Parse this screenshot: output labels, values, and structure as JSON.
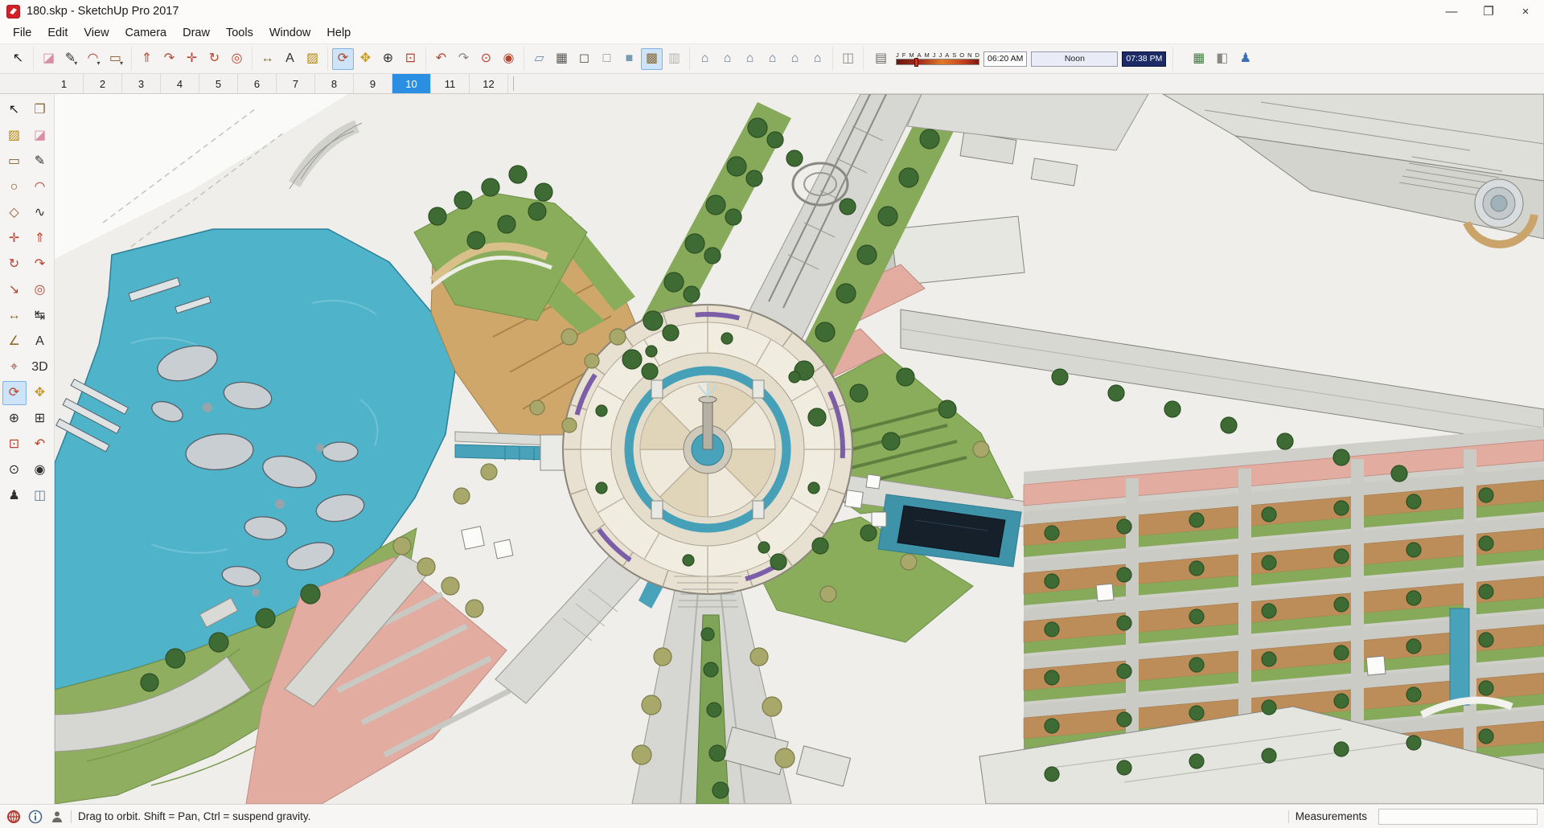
{
  "window": {
    "title": "180.skp - SketchUp Pro 2017",
    "controls": [
      {
        "name": "minimize",
        "glyph": "—"
      },
      {
        "name": "maximize",
        "glyph": "❐"
      },
      {
        "name": "close",
        "glyph": "×"
      }
    ]
  },
  "menu": {
    "items": [
      "File",
      "Edit",
      "View",
      "Camera",
      "Draw",
      "Tools",
      "Window",
      "Help"
    ]
  },
  "top_toolbar": {
    "groups": [
      {
        "name": "select",
        "tools": [
          {
            "name": "select",
            "glyph": "↖",
            "color": "#1a1a1a"
          }
        ]
      },
      {
        "name": "draw",
        "tools": [
          {
            "name": "eraser",
            "glyph": "◪",
            "color": "#d98fa5"
          },
          {
            "name": "line",
            "glyph": "✎",
            "color": "#2f2f2f",
            "dropdown": true
          },
          {
            "name": "arcs",
            "glyph": "◠",
            "color": "#b8452e",
            "dropdown": true
          },
          {
            "name": "shapes",
            "glyph": "▭",
            "color": "#8a5a2a",
            "dropdown": true
          }
        ]
      },
      {
        "name": "modify",
        "tools": [
          {
            "name": "push-pull",
            "glyph": "⇑",
            "color": "#b8452e"
          },
          {
            "name": "follow-me",
            "glyph": "↷",
            "color": "#b8452e"
          },
          {
            "name": "move",
            "glyph": "✛",
            "color": "#b8452e"
          },
          {
            "name": "rotate",
            "glyph": "↻",
            "color": "#b8452e"
          },
          {
            "name": "offset",
            "glyph": "◎",
            "color": "#b8452e"
          }
        ]
      },
      {
        "name": "construction",
        "tools": [
          {
            "name": "tape-measure",
            "glyph": "↔",
            "color": "#8a6b2a"
          },
          {
            "name": "text",
            "glyph": "A",
            "color": "#2f2f2f"
          },
          {
            "name": "paint-bucket",
            "glyph": "▨",
            "color": "#b8860b"
          }
        ]
      },
      {
        "name": "camera",
        "tools": [
          {
            "name": "orbit",
            "glyph": "⟳",
            "color": "#b8452e",
            "active": true
          },
          {
            "name": "pan",
            "glyph": "✥",
            "color": "#c9971e"
          },
          {
            "name": "zoom",
            "glyph": "⊕",
            "color": "#2f2f2f"
          },
          {
            "name": "zoom-extents",
            "glyph": "⊡",
            "color": "#b8452e"
          }
        ]
      },
      {
        "name": "walkthrough",
        "tools": [
          {
            "name": "previous",
            "glyph": "↶",
            "color": "#b8452e"
          },
          {
            "name": "next",
            "glyph": "↷",
            "color": "#8a8a84"
          },
          {
            "name": "position-camera",
            "glyph": "⊙",
            "color": "#b8452e"
          },
          {
            "name": "look-around",
            "glyph": "◉",
            "color": "#b8452e"
          }
        ]
      },
      {
        "name": "styles",
        "tools": [
          {
            "name": "x-ray",
            "glyph": "▱",
            "color": "#6a8fb0"
          },
          {
            "name": "back-edges",
            "glyph": "▦",
            "color": "#5a5a54"
          },
          {
            "name": "wireframe",
            "glyph": "◻",
            "color": "#5a5a54"
          },
          {
            "name": "hidden-line",
            "glyph": "□",
            "color": "#8a8a84"
          },
          {
            "name": "shaded",
            "glyph": "■",
            "color": "#7a9ab5"
          },
          {
            "name": "shaded-with-textures",
            "glyph": "▩",
            "color": "#8a6b3a",
            "active": true
          },
          {
            "name": "monochrome",
            "glyph": "▥",
            "color": "#b5b5af"
          }
        ]
      },
      {
        "name": "views",
        "tools": [
          {
            "name": "view-iso",
            "glyph": "⌂",
            "color": "#5a76a0"
          },
          {
            "name": "view-top",
            "glyph": "⌂",
            "color": "#5a76a0"
          },
          {
            "name": "view-front",
            "glyph": "⌂",
            "color": "#5a76a0"
          },
          {
            "name": "view-back",
            "glyph": "⌂",
            "color": "#5a76a0"
          },
          {
            "name": "view-left",
            "glyph": "⌂",
            "color": "#5a76a0"
          },
          {
            "name": "view-right",
            "glyph": "⌂",
            "color": "#5a76a0"
          }
        ]
      },
      {
        "name": "section",
        "tools": [
          {
            "name": "section-plane",
            "glyph": "◫",
            "color": "#8a8a84"
          }
        ]
      }
    ],
    "shadow": {
      "dialog_glyph": "▤",
      "months": [
        "J",
        "F",
        "M",
        "A",
        "M",
        "J",
        "J",
        "A",
        "S",
        "O",
        "N",
        "D"
      ],
      "start_time": "06:20 AM",
      "noon_label": "Noon",
      "end_time": "07:38 PM"
    },
    "right_tools": [
      {
        "name": "terrain-toggle",
        "glyph": "▦",
        "color": "#3f7d3a"
      },
      {
        "name": "surface-toggle",
        "glyph": "◧",
        "color": "#8a8a84"
      },
      {
        "name": "person-scale",
        "glyph": "♟",
        "color": "#3b6fb5"
      }
    ]
  },
  "scene_tabs": {
    "tabs": [
      "1",
      "2",
      "3",
      "4",
      "5",
      "6",
      "7",
      "8",
      "9",
      "10",
      "11",
      "12"
    ],
    "active": "10"
  },
  "left_toolbar": {
    "tools": [
      {
        "name": "select",
        "glyph": "↖",
        "color": "#1a1a1a"
      },
      {
        "name": "make-component",
        "glyph": "❐",
        "color": "#8a6b3a"
      },
      {
        "name": "paint-bucket",
        "glyph": "▨",
        "color": "#b8860b"
      },
      {
        "name": "eraser",
        "glyph": "◪",
        "color": "#d98fa5"
      },
      {
        "name": "rectangle",
        "glyph": "▭",
        "color": "#8a5a2a"
      },
      {
        "name": "line",
        "glyph": "✎",
        "color": "#2f2f2f"
      },
      {
        "name": "circle",
        "glyph": "○",
        "color": "#8a5a2a"
      },
      {
        "name": "arc",
        "glyph": "◠",
        "color": "#b8452e"
      },
      {
        "name": "polygon",
        "glyph": "◇",
        "color": "#8a5a2a"
      },
      {
        "name": "freehand",
        "glyph": "∿",
        "color": "#2f2f2f"
      },
      {
        "name": "move",
        "glyph": "✛",
        "color": "#b8452e"
      },
      {
        "name": "push-pull",
        "glyph": "⇑",
        "color": "#b8452e"
      },
      {
        "name": "rotate",
        "glyph": "↻",
        "color": "#b8452e"
      },
      {
        "name": "follow-me",
        "glyph": "↷",
        "color": "#b8452e"
      },
      {
        "name": "scale",
        "glyph": "↘",
        "color": "#b8452e"
      },
      {
        "name": "offset",
        "glyph": "◎",
        "color": "#b8452e"
      },
      {
        "name": "tape-measure",
        "glyph": "↔",
        "color": "#8a6b2a"
      },
      {
        "name": "dimension",
        "glyph": "↹",
        "color": "#2f2f2f"
      },
      {
        "name": "protractor",
        "glyph": "∠",
        "color": "#8a6b2a"
      },
      {
        "name": "text",
        "glyph": "A",
        "color": "#2f2f2f"
      },
      {
        "name": "axes",
        "glyph": "⌖",
        "color": "#b8452e"
      },
      {
        "name": "3d-text",
        "glyph": "3D",
        "color": "#2f2f2f"
      },
      {
        "name": "orbit",
        "glyph": "⟳",
        "color": "#b8452e",
        "active": true
      },
      {
        "name": "pan",
        "glyph": "✥",
        "color": "#c9971e"
      },
      {
        "name": "zoom",
        "glyph": "⊕",
        "color": "#2f2f2f"
      },
      {
        "name": "zoom-window",
        "glyph": "⊞",
        "color": "#2f2f2f"
      },
      {
        "name": "zoom-extents",
        "glyph": "⊡",
        "color": "#b8452e"
      },
      {
        "name": "previous",
        "glyph": "↶",
        "color": "#b8452e"
      },
      {
        "name": "position-camera",
        "glyph": "⊙",
        "color": "#2f2f2f"
      },
      {
        "name": "look-around",
        "glyph": "◉",
        "color": "#2f2f2f"
      },
      {
        "name": "walk",
        "glyph": "♟",
        "color": "#2f2f2f"
      },
      {
        "name": "section-plane",
        "glyph": "◫",
        "color": "#5b7fa6"
      }
    ]
  },
  "status_bar": {
    "hint": "Drag to orbit. Shift = Pan, Ctrl = suspend gravity.",
    "measurements_label": "Measurements",
    "measurements_value": ""
  },
  "canvas": {
    "palette": {
      "background": "#efeeea",
      "water": "#4fb3c9",
      "water_edge": "#2e8097",
      "grass": "#8aad5c",
      "grass_dark": "#6d8f49",
      "tree_dark": "#3e6b33",
      "tree_pale": "#a9a86b",
      "road": "#d6d6d2",
      "road_edge": "#97978f",
      "paving_tan": "#cfa76b",
      "paving_pink": "#e3aca1",
      "building": "#dededa",
      "plaza_ring": "#e8e1d2",
      "pool_dark": "#15202b",
      "channel_teal": "#47a2ba",
      "accent_purple": "#7b5ea7",
      "active_tab": "#2a8fe2"
    }
  }
}
